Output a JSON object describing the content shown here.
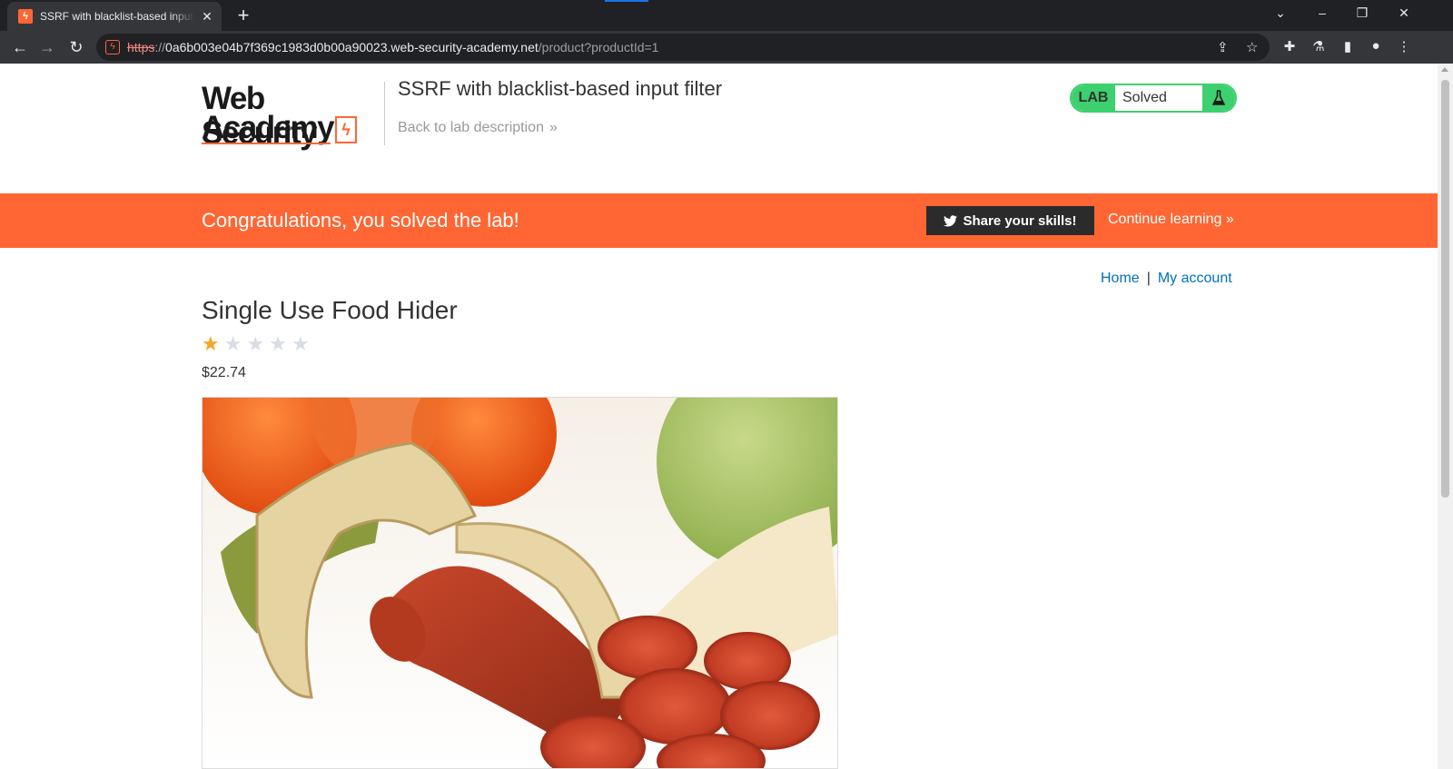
{
  "browser": {
    "tab_title": "SSRF with blacklist-based input filter",
    "tab_favicon_glyph": "ϟ",
    "new_tab_glyph": "+",
    "url": {
      "scheme": "https",
      "separator": "://",
      "host": "0a6b003e04b7f369c1983d0b00a90023.web-security-academy.net",
      "path": "/product?productId=1"
    }
  },
  "header": {
    "logo_line1": "Web Security",
    "logo_line2": "Academy",
    "logo_bolt": "ϟ",
    "lab_title": "SSRF with blacklist-based input filter",
    "back_link": "Back to lab description",
    "back_chevron": "»",
    "badge": {
      "tag": "LAB",
      "status": "Solved",
      "color": "#3dd06e"
    }
  },
  "congrats": {
    "message": "Congratulations, you solved the lab!",
    "share_label": "Share your skills!",
    "continue_label": "Continue learning »",
    "bar_color": "#ff6633"
  },
  "nav": {
    "home": "Home",
    "separator": "|",
    "account": "My account"
  },
  "product": {
    "title": "Single Use Food Hider",
    "rating": 1,
    "rating_max": 5,
    "price": "$22.74"
  },
  "icons": {
    "star": "★"
  }
}
